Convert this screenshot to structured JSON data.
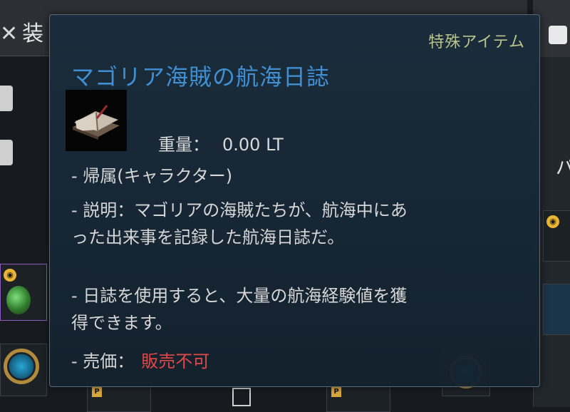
{
  "background": {
    "panel_title": "装",
    "side_label": "パ",
    "slot_badge": "P"
  },
  "tooltip": {
    "category": "特殊アイテム",
    "item_name": "マゴリア海賊の航海日誌",
    "weight_label": "重量：",
    "weight_value": "0.00 LT",
    "binding": "- 帰属(キャラクター)",
    "description_line1": "- 説明：マゴリアの海賊たちが、航海中にあ",
    "description_line2": "った出来事を記録した航海日誌だ。",
    "usage_line1": "- 日誌を使用すると、大量の航海経験値を獲",
    "usage_line2": "得できます。",
    "price_label": "- 売価：",
    "price_value": "販売不可",
    "colors": {
      "item_name": "#3f8fd2",
      "category": "#b9c48a",
      "price_value": "#e04848"
    }
  }
}
